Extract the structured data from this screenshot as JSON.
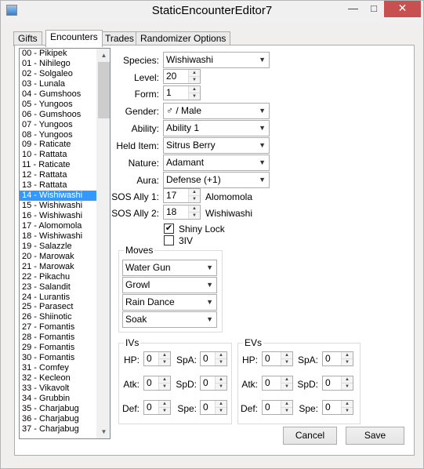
{
  "window": {
    "title": "StaticEncounterEditor7"
  },
  "tabs": [
    "Gifts",
    "Encounters",
    "Trades",
    "Randomizer Options"
  ],
  "encounters": [
    "00 - Pikipek",
    "01 - Nihilego",
    "02 - Solgaleo",
    "03 - Lunala",
    "04 - Gumshoos",
    "05 - Yungoos",
    "06 - Gumshoos",
    "07 - Yungoos",
    "08 - Yungoos",
    "09 - Raticate",
    "10 - Rattata",
    "11 - Raticate",
    "12 - Rattata",
    "13 - Rattata",
    "14 - Wishiwashi",
    "15 - Wishiwashi",
    "16 - Wishiwashi",
    "17 - Alomomola",
    "18 - Wishiwashi",
    "19 - Salazzle",
    "20 - Marowak",
    "21 - Marowak",
    "22 - Pikachu",
    "23 - Salandit",
    "24 - Lurantis",
    "25 - Parasect",
    "26 - Shiinotic",
    "27 - Fomantis",
    "28 - Fomantis",
    "29 - Fomantis",
    "30 - Fomantis",
    "31 - Comfey",
    "32 - Kecleon",
    "33 - Vikavolt",
    "34 - Grubbin",
    "35 - Charjabug",
    "36 - Charjabug",
    "37 - Charjabug"
  ],
  "selected_index": 14,
  "form": {
    "species_label": "Species:",
    "species": "Wishiwashi",
    "level_label": "Level:",
    "level": "20",
    "form_label": "Form:",
    "form": "1",
    "gender_label": "Gender:",
    "gender": "♂ / Male",
    "ability_label": "Ability:",
    "ability": "Ability 1",
    "held_item_label": "Held Item:",
    "held_item": "Sitrus Berry",
    "nature_label": "Nature:",
    "nature": "Adamant",
    "aura_label": "Aura:",
    "aura": "Defense (+1)",
    "sos1_label": "SOS Ally 1:",
    "sos1": "17",
    "sos1_name": "Alomomola",
    "sos2_label": "SOS Ally 2:",
    "sos2": "18",
    "sos2_name": "Wishiwashi",
    "shiny_lock_label": "Shiny Lock",
    "shiny_lock": true,
    "iv3_label": "3IV",
    "iv3": false
  },
  "moves": {
    "title": "Moves",
    "items": [
      "Water Gun",
      "Growl",
      "Rain Dance",
      "Soak"
    ]
  },
  "ivs": {
    "title": "IVs",
    "hp_label": "HP:",
    "hp": "0",
    "atk_label": "Atk:",
    "atk": "0",
    "def_label": "Def:",
    "def": "0",
    "spa_label": "SpA:",
    "spa": "0",
    "spd_label": "SpD:",
    "spd": "0",
    "spe_label": "Spe:",
    "spe": "0"
  },
  "evs": {
    "title": "EVs",
    "hp_label": "HP:",
    "hp": "0",
    "atk_label": "Atk:",
    "atk": "0",
    "def_label": "Def:",
    "def": "0",
    "spa_label": "SpA:",
    "spa": "0",
    "spd_label": "SpD:",
    "spd": "0",
    "spe_label": "Spe:",
    "spe": "0"
  },
  "buttons": {
    "cancel": "Cancel",
    "save": "Save"
  },
  "caption": {
    "minimize": "—",
    "maximize": "□",
    "close": "✕"
  },
  "icons": {
    "dropdown": "▼",
    "spin_up": "▲",
    "spin_down": "▼",
    "check": "✔"
  }
}
